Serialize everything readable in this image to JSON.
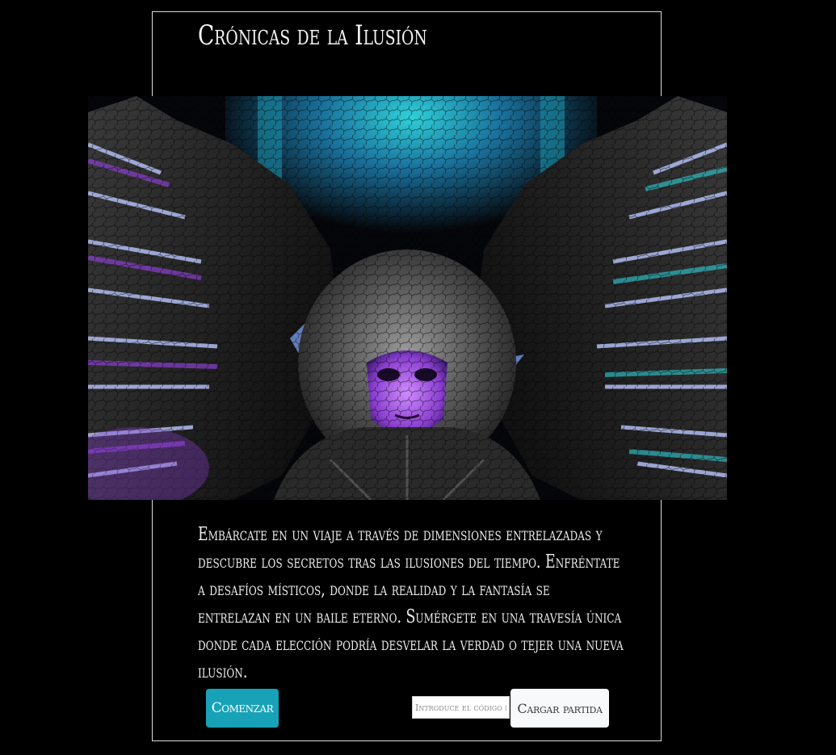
{
  "header": {
    "title": "Crónicas de la Ilusión"
  },
  "hero": {
    "image_subject": "winged-masked-angel-illustration"
  },
  "intro": {
    "text": "Embárcate en un viaje a través de dimensiones entrelazadas y descubre los secretos tras las ilusiones del tiempo. Enfréntate a desafíos místicos, donde la realidad y la fantasía se entrelazan en un baile eterno. Sumérgete en una travesía única donde cada elección podría desvelar la verdad o tejer una nueva ilusión."
  },
  "actions": {
    "start_label": "Comenzar",
    "code_placeholder": "Introduce el código de partida",
    "code_value": "",
    "load_label": "Cargar partida"
  },
  "colors": {
    "background": "#000000",
    "start_button": "#17a2b8",
    "load_button": "#f8f9fa",
    "frame_border": "#d9d9d9"
  }
}
